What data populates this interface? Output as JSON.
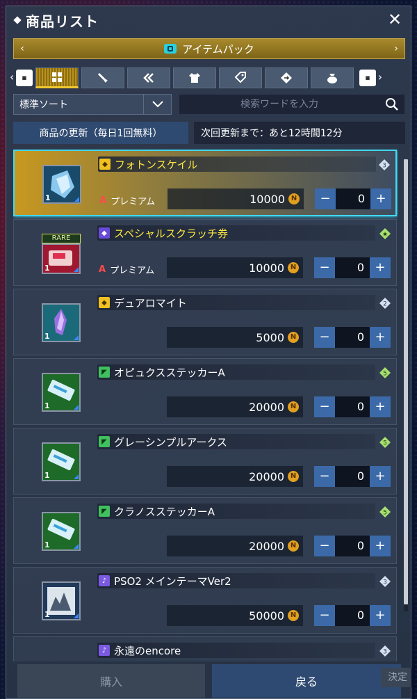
{
  "window": {
    "title": "商品リスト"
  },
  "category": {
    "label": "アイテムパック"
  },
  "tabs": [
    {
      "name": "tab-all",
      "icon": "grid-icon"
    },
    {
      "name": "tab-weapon",
      "icon": "sword-icon"
    },
    {
      "name": "tab-skill",
      "icon": "double-chevron-icon"
    },
    {
      "name": "tab-costume",
      "icon": "shirt-icon"
    },
    {
      "name": "tab-tag",
      "icon": "tag-icon"
    },
    {
      "name": "tab-ticket",
      "icon": "diamond-arrow-icon"
    },
    {
      "name": "tab-bag",
      "icon": "bag-icon"
    }
  ],
  "sort": {
    "value": "標準ソート"
  },
  "search": {
    "placeholder": "検索ワードを入力"
  },
  "refresh": {
    "button_label": "商品の更新（毎日1回無料）",
    "info": "次回更新まで：あと12時間12分"
  },
  "items": [
    {
      "name": "フォトンスケイル",
      "premium": "プレミアム",
      "price": "10000",
      "qty": "0",
      "count": "1",
      "rank": "3",
      "selected": true,
      "rare": ""
    },
    {
      "name": "スペシャルスクラッチ券",
      "premium": "プレミアム",
      "price": "10000",
      "qty": "0",
      "count": "1",
      "rank": "★",
      "selected": false,
      "rare": "RARE"
    },
    {
      "name": "デュアロマイト",
      "premium": "",
      "price": "5000",
      "qty": "0",
      "count": "1",
      "rank": "2",
      "selected": false,
      "rare": ""
    },
    {
      "name": "オピュクスステッカーA",
      "premium": "",
      "price": "20000",
      "qty": "0",
      "count": "1",
      "rank": "5",
      "selected": false,
      "rare": ""
    },
    {
      "name": "グレーシンプルアークス",
      "premium": "",
      "price": "20000",
      "qty": "0",
      "count": "1",
      "rank": "5",
      "selected": false,
      "rare": ""
    },
    {
      "name": "クラノスステッカーA",
      "premium": "",
      "price": "20000",
      "qty": "0",
      "count": "1",
      "rank": "5",
      "selected": false,
      "rare": ""
    },
    {
      "name": "PSO2 メインテーマVer2",
      "premium": "",
      "price": "50000",
      "qty": "0",
      "count": "1",
      "rank": "3",
      "selected": false,
      "rare": ""
    },
    {
      "name": "永遠のencore",
      "premium": "",
      "price": "",
      "qty": "",
      "count": "",
      "rank": "3",
      "selected": false,
      "rare": ""
    }
  ],
  "footer": {
    "buy_label": "購入",
    "back_label": "戻る",
    "decide_label": "決定"
  },
  "colors": {
    "accent": "#40d8f0",
    "gold": "#ffe840",
    "panel": "#2e3a4e"
  }
}
